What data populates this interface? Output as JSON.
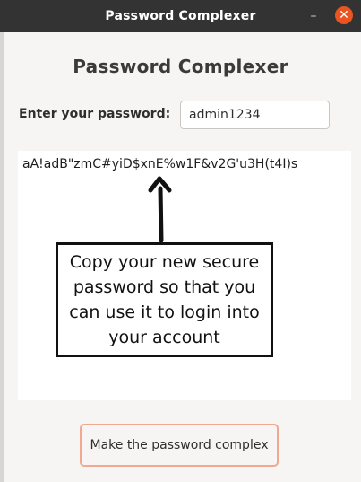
{
  "window": {
    "title": "Password Complexer",
    "minimize_glyph": "–",
    "close_glyph": "✕"
  },
  "app": {
    "heading": "Password Complexer",
    "prompt_label": "Enter your password:",
    "password_value": "admin1234",
    "generated_password": "aA!adB\"zmC#yiD$xnE%w1F&v2G'u3H(t4I)s",
    "callout_text": "Copy your new secure password so that you can use it to login into your account",
    "button_label": "Make the password complex"
  },
  "colors": {
    "titlebar": "#333333",
    "close_button": "#e95420",
    "button_border": "#f0a890"
  }
}
